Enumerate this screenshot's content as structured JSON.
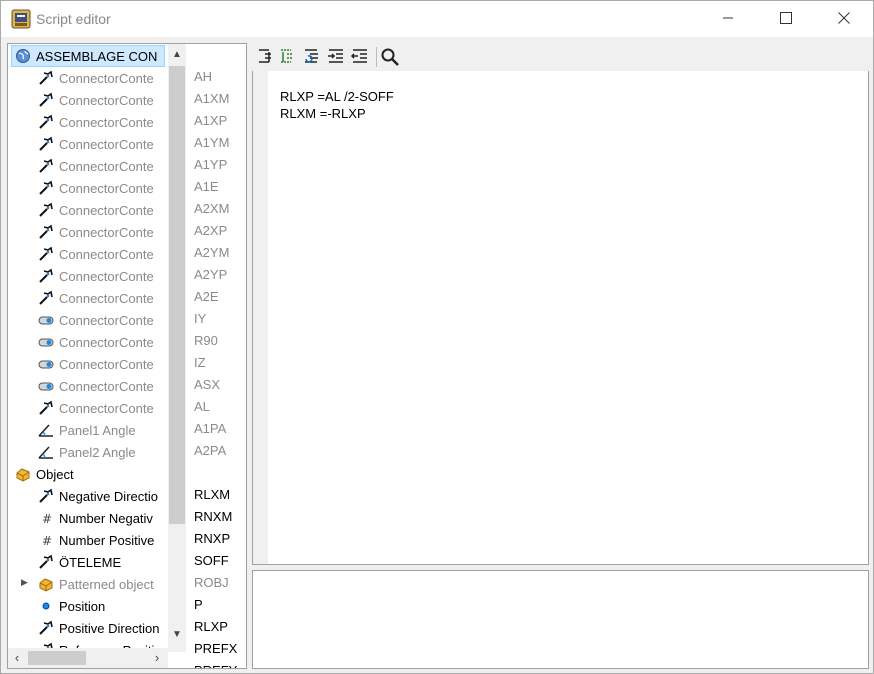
{
  "window": {
    "title": "Script editor"
  },
  "tree": {
    "root": {
      "label": "ASSEMBLAGE CON",
      "icon": "globe-icon"
    },
    "children": [
      {
        "label": "ConnectorConte",
        "icon": "connector-icon",
        "var": "AH"
      },
      {
        "label": "ConnectorConte",
        "icon": "connector-icon",
        "var": "A1XM"
      },
      {
        "label": "ConnectorConte",
        "icon": "connector-icon",
        "var": "A1XP"
      },
      {
        "label": "ConnectorConte",
        "icon": "connector-icon",
        "var": "A1YM"
      },
      {
        "label": "ConnectorConte",
        "icon": "connector-icon",
        "var": "A1YP"
      },
      {
        "label": "ConnectorConte",
        "icon": "connector-icon",
        "var": "A1E"
      },
      {
        "label": "ConnectorConte",
        "icon": "connector-icon",
        "var": "A2XM"
      },
      {
        "label": "ConnectorConte",
        "icon": "connector-icon",
        "var": "A2XP"
      },
      {
        "label": "ConnectorConte",
        "icon": "connector-icon",
        "var": "A2YM"
      },
      {
        "label": "ConnectorConte",
        "icon": "connector-icon",
        "var": "A2YP"
      },
      {
        "label": "ConnectorConte",
        "icon": "connector-icon",
        "var": "A2E"
      },
      {
        "label": "ConnectorConte",
        "icon": "toggle-icon",
        "var": "IY"
      },
      {
        "label": "ConnectorConte",
        "icon": "toggle-icon",
        "var": "R90"
      },
      {
        "label": "ConnectorConte",
        "icon": "toggle-icon",
        "var": "IZ"
      },
      {
        "label": "ConnectorConte",
        "icon": "toggle-icon",
        "var": "ASX"
      },
      {
        "label": "ConnectorConte",
        "icon": "connector-icon",
        "var": "AL"
      },
      {
        "label": "Panel1 Angle",
        "icon": "angle-icon",
        "var": "A1PA"
      },
      {
        "label": "Panel2 Angle",
        "icon": "angle-icon",
        "var": "A2PA"
      }
    ],
    "object": {
      "label": "Object",
      "icon": "object-icon"
    },
    "objectChildren": [
      {
        "label": "Negative Directio",
        "icon": "connector-icon",
        "var": "RLXM"
      },
      {
        "label": "Number Negativ",
        "icon": "hash-icon",
        "var": "RNXM"
      },
      {
        "label": "Number Positive",
        "icon": "hash-icon",
        "var": "RNXP"
      },
      {
        "label": "ÖTELEME",
        "icon": "connector-icon",
        "var": "SOFF"
      },
      {
        "label": "Patterned object",
        "icon": "object-icon",
        "var": "ROBJ"
      },
      {
        "label": "Position",
        "icon": "dot-icon",
        "var": "P"
      },
      {
        "label": "Positive Direction",
        "icon": "connector-icon",
        "var": "RLXP"
      },
      {
        "label": "Reference Positi",
        "icon": "connector-icon",
        "var": "PREFX"
      },
      {
        "label": "",
        "icon": "",
        "var": "PREFY"
      }
    ]
  },
  "toolbar": {
    "buttons": [
      "indent-icon",
      "comment-icon",
      "uncomment-icon",
      "increase-indent-icon",
      "decrease-indent-icon",
      "search-icon"
    ]
  },
  "editor": {
    "lines": [
      "RLXP =AL /2-SOFF",
      "RLXM =-RLXP"
    ]
  },
  "colors": {
    "selection": "#cde8ff",
    "active": "#000000",
    "inactive": "#8a8a8a"
  }
}
